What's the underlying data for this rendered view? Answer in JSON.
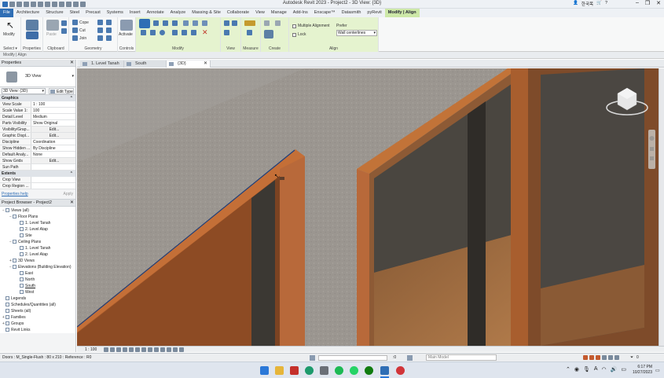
{
  "window": {
    "title": "Autodesk Revit 2023 - Project2 - 3D View: {3D}",
    "user": "한국목",
    "help": "?"
  },
  "ribbon_tabs": [
    "File",
    "Architecture",
    "Structure",
    "Steel",
    "Precast",
    "Systems",
    "Insert",
    "Annotate",
    "Analyze",
    "Massing & Site",
    "Collaborate",
    "View",
    "Manage",
    "Add-Ins",
    "Enscape™",
    "Datasmith",
    "pyRevit",
    "Modify | Align"
  ],
  "ribbon": {
    "select_label": "Select ▾",
    "modify_label": "Modify",
    "properties_label": "Properties",
    "paste_label": "Paste",
    "clipboard_label": "Clipboard",
    "cope_label": "Cope",
    "cut_label": "Cut",
    "join_label": "Join",
    "geometry_label": "Geometry",
    "activate_label": "Activate",
    "controls_label": "Controls",
    "modify_group_label": "Modify",
    "view_label": "View",
    "measure_label": "Measure",
    "create_label": "Create",
    "align_label": "Align",
    "multiple_alignment": "Multiple Alignment",
    "lock": "Lock",
    "prefer_label": "Prefer",
    "prefer_value": "Wall centerlines"
  },
  "options_bar": "Modify | Align",
  "properties": {
    "header": "Properties",
    "type_name": "3D View",
    "instance_selector": "3D View: {3D}",
    "edit_type": "Edit Type",
    "graphics_section": "Graphics",
    "rows": [
      {
        "k": "View Scale",
        "v": "1 : 100"
      },
      {
        "k": "Scale Value  1:",
        "v": "100"
      },
      {
        "k": "Detail Level",
        "v": "Medium"
      },
      {
        "k": "Parts Visibility",
        "v": "Show Original"
      },
      {
        "k": "Visibility/Grap...",
        "v": "Edit..."
      },
      {
        "k": "Graphic Displ...",
        "v": "Edit..."
      },
      {
        "k": "Discipline",
        "v": "Coordination"
      },
      {
        "k": "Show Hidden ...",
        "v": "By Discipline"
      },
      {
        "k": "Default Analy...",
        "v": "None"
      },
      {
        "k": "Show Grids",
        "v": "Edit..."
      },
      {
        "k": "Sun Path",
        "v": ""
      }
    ],
    "extents_section": "Extents",
    "extents_rows": [
      {
        "k": "Crop View",
        "v": ""
      },
      {
        "k": "Crop Region ...",
        "v": ""
      }
    ],
    "help_link": "Properties help",
    "apply": "Apply"
  },
  "project_browser": {
    "header": "Project Browser - Project2",
    "items": [
      {
        "label": "Views (all)",
        "level": 0,
        "ex": "−"
      },
      {
        "label": "Floor Plans",
        "level": 1,
        "ex": "−"
      },
      {
        "label": "1. Level Tanah",
        "level": 2,
        "ex": ""
      },
      {
        "label": "2. Level Atap",
        "level": 2,
        "ex": ""
      },
      {
        "label": "Site",
        "level": 2,
        "ex": ""
      },
      {
        "label": "Ceiling Plans",
        "level": 1,
        "ex": "−"
      },
      {
        "label": "1. Level Tanah",
        "level": 2,
        "ex": ""
      },
      {
        "label": "2. Level Atap",
        "level": 2,
        "ex": ""
      },
      {
        "label": "3D Views",
        "level": 1,
        "ex": "+"
      },
      {
        "label": "Elevations (Building Elevation)",
        "level": 1,
        "ex": "−"
      },
      {
        "label": "East",
        "level": 2,
        "ex": ""
      },
      {
        "label": "North",
        "level": 2,
        "ex": ""
      },
      {
        "label": "South",
        "level": 2,
        "ex": ""
      },
      {
        "label": "West",
        "level": 2,
        "ex": ""
      },
      {
        "label": "Legends",
        "level": 0,
        "ex": ""
      },
      {
        "label": "Schedules/Quantities (all)",
        "level": 0,
        "ex": ""
      },
      {
        "label": "Sheets (all)",
        "level": 0,
        "ex": ""
      },
      {
        "label": "Families",
        "level": 0,
        "ex": "+"
      },
      {
        "label": "Groups",
        "level": 0,
        "ex": "+"
      },
      {
        "label": "Revit Links",
        "level": 0,
        "ex": ""
      }
    ]
  },
  "view_tabs": [
    {
      "label": "1. Level Tanah",
      "active": false
    },
    {
      "label": "South",
      "active": false
    },
    {
      "label": "{3D}",
      "active": true
    }
  ],
  "view_control_bar": {
    "scale": "1 : 100"
  },
  "status_bar": {
    "left": "Doors : M_Single-Flush : 80 x 210 : Reference : R0",
    "zero": ":0",
    "model": "Main Model",
    "filter": "0"
  },
  "taskbar": {
    "time": "6:17 PM",
    "date": "10/27/2023"
  },
  "colors": {
    "ribbon_context": "#cde8a8",
    "file_tab": "#2f6eb5",
    "door_frame": "#b5612f",
    "door_panel": "#a4582b",
    "wall": "#9a9590"
  }
}
